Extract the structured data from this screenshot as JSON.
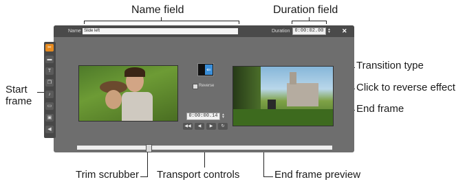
{
  "callouts": {
    "name_field": "Name field",
    "duration_field": "Duration field",
    "transition_type": "Transition type",
    "reverse_effect": "Click to reverse effect",
    "start_frame_1": "Start",
    "start_frame_2": "frame",
    "end_frame": "End frame",
    "trim_scrubber": "Trim scrubber",
    "transport_controls": "Transport controls",
    "end_frame_preview": "End frame preview"
  },
  "editor": {
    "name_label": "Name",
    "name_value": "Slide left",
    "duration_label": "Duration",
    "duration_value": "0:00:02.00",
    "close_icon": "close-icon",
    "reverse_label": "Reverse",
    "transport_timecode": "0:00:00.14",
    "tools": [
      "scissors-icon",
      "film-icon",
      "text-icon",
      "layers-icon",
      "audio-icon",
      "folder-icon",
      "image-icon",
      "speaker-icon"
    ],
    "transport": [
      "rewind-icon",
      "step-back-icon",
      "play-icon",
      "loop-icon"
    ],
    "accent_color": "#e68a1f",
    "transition_color": "#3a8ed8",
    "trim_position": 0.27
  }
}
